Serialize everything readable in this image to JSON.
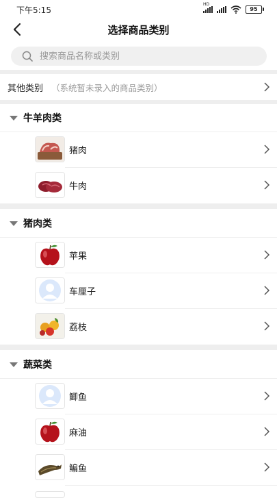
{
  "status_bar": {
    "time": "下午5:15",
    "hd": "HD",
    "battery": "95"
  },
  "nav": {
    "title": "选择商品类别",
    "back_icon": "chevron-left-icon"
  },
  "search": {
    "placeholder": "搜索商品名称或类别",
    "value": ""
  },
  "other_category": {
    "label": "其他类别",
    "note": "（系统暂未录入的商品类别）"
  },
  "sections": [
    {
      "title": "牛羊肉类",
      "items": [
        {
          "label": "猪肉",
          "image": "raw-meat"
        },
        {
          "label": "牛肉",
          "image": "beef"
        }
      ]
    },
    {
      "title": "猪肉类",
      "items": [
        {
          "label": "苹果",
          "image": "apple"
        },
        {
          "label": "车厘子",
          "image": "placeholder-avatar"
        },
        {
          "label": "荔枝",
          "image": "fruit-bowl"
        }
      ]
    },
    {
      "title": "蔬菜类",
      "items": [
        {
          "label": "鲫鱼",
          "image": "placeholder-avatar"
        },
        {
          "label": "麻油",
          "image": "apple"
        },
        {
          "label": "鳊鱼",
          "image": "fish"
        }
      ]
    }
  ],
  "colors": {
    "divider": "#eeeeee",
    "search_bg": "#f0f0f0",
    "muted_text": "#9a9a9a"
  }
}
